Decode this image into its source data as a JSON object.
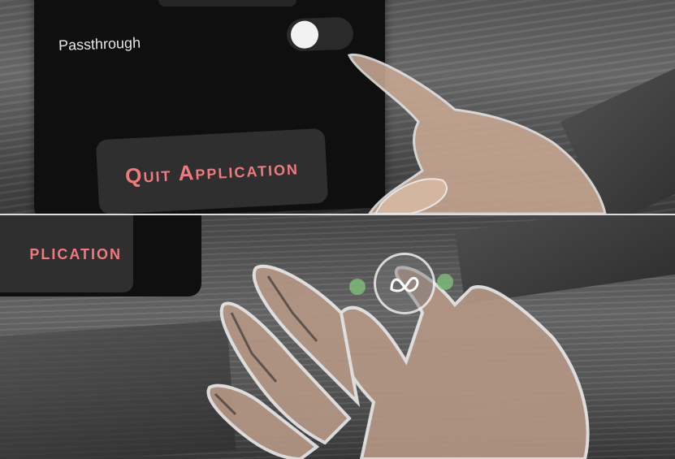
{
  "settings_panel": {
    "passthrough_label": "Passthrough",
    "passthrough_enabled": true,
    "quit_button_label": "Quit Application"
  },
  "bottom_view": {
    "quit_button_label_partial": "plication",
    "menu_icon": "meta-logo-icon"
  },
  "colors": {
    "panel_background": "#0f0f0f",
    "button_background": "#2f2f2f",
    "quit_text": "#f07a80",
    "toggle_knob": "#f2f2f2"
  }
}
